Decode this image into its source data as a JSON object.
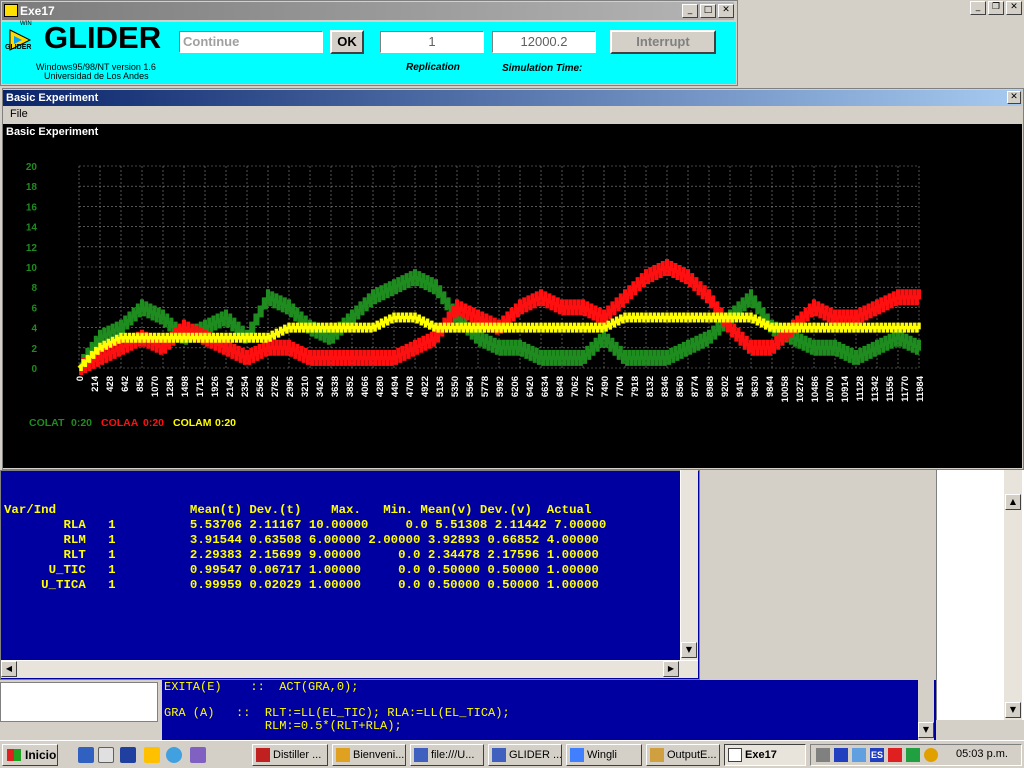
{
  "glider": {
    "window_title": "Exe17",
    "logo_text": "GLIDER",
    "logo_small": "WIN",
    "logo_icon_label": "GLIDER",
    "subtitle1": "Windows95/98/NT version 1.6",
    "subtitle2": "Universidad de Los Andes",
    "continue_value": "Continue",
    "ok_label": "OK",
    "replication_value": "1",
    "simulation_time_value": "12000.2",
    "interrupt_label": "Interrupt",
    "replication_label": "Replication",
    "simulation_time_label": "Simulation Time:"
  },
  "experiment": {
    "window_title": "Basic Experiment",
    "menu_file": "File",
    "plot_heading": "Basic Experiment",
    "legend": [
      {
        "label": "COLAT",
        "range": "0:20",
        "color": "#1e8c1e"
      },
      {
        "label": "COLAA",
        "range": "0:20",
        "color": "#ff1010"
      },
      {
        "label": "COLAM",
        "range": "0:20",
        "color": "#ffff00"
      }
    ]
  },
  "chart_data": {
    "type": "line",
    "x_ticks": [
      "0",
      "214",
      "428",
      "642",
      "856",
      "1070",
      "1284",
      "1498",
      "1712",
      "1926",
      "2140",
      "2354",
      "2568",
      "2782",
      "2996",
      "3210",
      "3424",
      "3638",
      "3852",
      "4066",
      "4280",
      "4494",
      "4708",
      "4922",
      "5136",
      "5350",
      "5564",
      "5778",
      "5992",
      "6206",
      "6420",
      "6634",
      "6848",
      "7062",
      "7276",
      "7490",
      "7704",
      "7918",
      "8132",
      "8346",
      "8560",
      "8774",
      "8988",
      "9202",
      "9416",
      "9630",
      "9844",
      "10058",
      "10272",
      "10486",
      "10700",
      "10914",
      "11128",
      "11342",
      "11556",
      "11770",
      "11984"
    ],
    "y_ticks": [
      "0",
      "2",
      "4",
      "6",
      "8",
      "10",
      "12",
      "14",
      "16",
      "18",
      "20"
    ],
    "ylim": [
      0,
      20
    ],
    "xlim": [
      0,
      12000
    ],
    "grid": true,
    "series": [
      {
        "name": "COLAT",
        "color": "#1e8c1e",
        "x": [
          0,
          300,
          600,
          900,
          1200,
          1500,
          1800,
          2100,
          2400,
          2700,
          3000,
          3300,
          3600,
          3900,
          4200,
          4500,
          4800,
          5100,
          5400,
          5700,
          6000,
          6300,
          6600,
          6900,
          7200,
          7500,
          7800,
          8100,
          8400,
          8700,
          9000,
          9300,
          9600,
          9900,
          10200,
          10500,
          10800,
          11100,
          11400,
          11700,
          12000
        ],
        "y": [
          0,
          3,
          4,
          6,
          5,
          3,
          4,
          5,
          3,
          7,
          6,
          4,
          3,
          5,
          7,
          8,
          9,
          8,
          5,
          3,
          2,
          2,
          1,
          1,
          1,
          3,
          1,
          1,
          1,
          2,
          3,
          5,
          7,
          4,
          3,
          2,
          2,
          1,
          2,
          3,
          2
        ]
      },
      {
        "name": "COLAA",
        "color": "#ff1010",
        "x": [
          0,
          300,
          600,
          900,
          1200,
          1500,
          1800,
          2100,
          2400,
          2700,
          3000,
          3300,
          3600,
          3900,
          4200,
          4500,
          4800,
          5100,
          5400,
          5700,
          6000,
          6300,
          6600,
          6900,
          7200,
          7500,
          7800,
          8100,
          8400,
          8700,
          9000,
          9300,
          9600,
          9900,
          10200,
          10500,
          10800,
          11100,
          11400,
          11700,
          12000
        ],
        "y": [
          0,
          1,
          2,
          3,
          2,
          4,
          3,
          2,
          1,
          2,
          2,
          1,
          1,
          1,
          1,
          1,
          2,
          3,
          6,
          5,
          4,
          6,
          7,
          6,
          6,
          5,
          7,
          9,
          10,
          9,
          7,
          4,
          2,
          2,
          4,
          6,
          5,
          5,
          6,
          7,
          7
        ]
      },
      {
        "name": "COLAM",
        "color": "#ffff00",
        "x": [
          0,
          300,
          600,
          900,
          1200,
          1500,
          1800,
          2100,
          2400,
          2700,
          3000,
          3300,
          3600,
          3900,
          4200,
          4500,
          4800,
          5100,
          5400,
          5700,
          6000,
          6300,
          6600,
          6900,
          7200,
          7500,
          7800,
          8100,
          8400,
          8700,
          9000,
          9300,
          9600,
          9900,
          10200,
          10500,
          10800,
          11100,
          11400,
          11700,
          12000
        ],
        "y": [
          0,
          2,
          3,
          3,
          3,
          3,
          3,
          3,
          3,
          3,
          4,
          4,
          4,
          4,
          4,
          5,
          5,
          4,
          4,
          4,
          4,
          4,
          4,
          4,
          4,
          4,
          5,
          5,
          5,
          5,
          5,
          5,
          5,
          4,
          4,
          4,
          4,
          4,
          4,
          4,
          4
        ]
      }
    ]
  },
  "output": {
    "header": "Var/Ind                  Mean(t) Dev.(t)    Max.   Min. Mean(v) Dev.(v)  Actual",
    "rows": [
      "        RLA   1          5.53706 2.11167 10.00000     0.0 5.51308 2.11442 7.00000",
      "        RLM   1          3.91544 0.63508 6.00000 2.00000 3.92893 0.66852 4.00000",
      "        RLT   1          2.29383 2.15699 9.00000     0.0 2.34478 2.17596 1.00000",
      "      U_TIC   1          0.99547 0.06717 1.00000     0.0 0.50000 0.50000 1.00000",
      "     U_TICA   1          0.99959 0.02029 1.00000     0.0 0.50000 0.50000 1.00000"
    ]
  },
  "code": {
    "line1": "EXITA(E)    ::  ACT(GRA,0);",
    "line2": "",
    "line3": "GRA (A)   ::  RLT:=LL(EL_TIC); RLA:=LL(EL_TICA);",
    "line4": "              RLM:=0.5*(RLT+RLA);"
  },
  "taskbar": {
    "start_label": "Inicio",
    "tasks": [
      "Distiller ...",
      "Bienveni...",
      "file:///U...",
      "GLIDER ...",
      "Wingli",
      "OutputE...",
      "Exe17"
    ],
    "clock": "05:03 p.m.",
    "lang": "ES"
  }
}
